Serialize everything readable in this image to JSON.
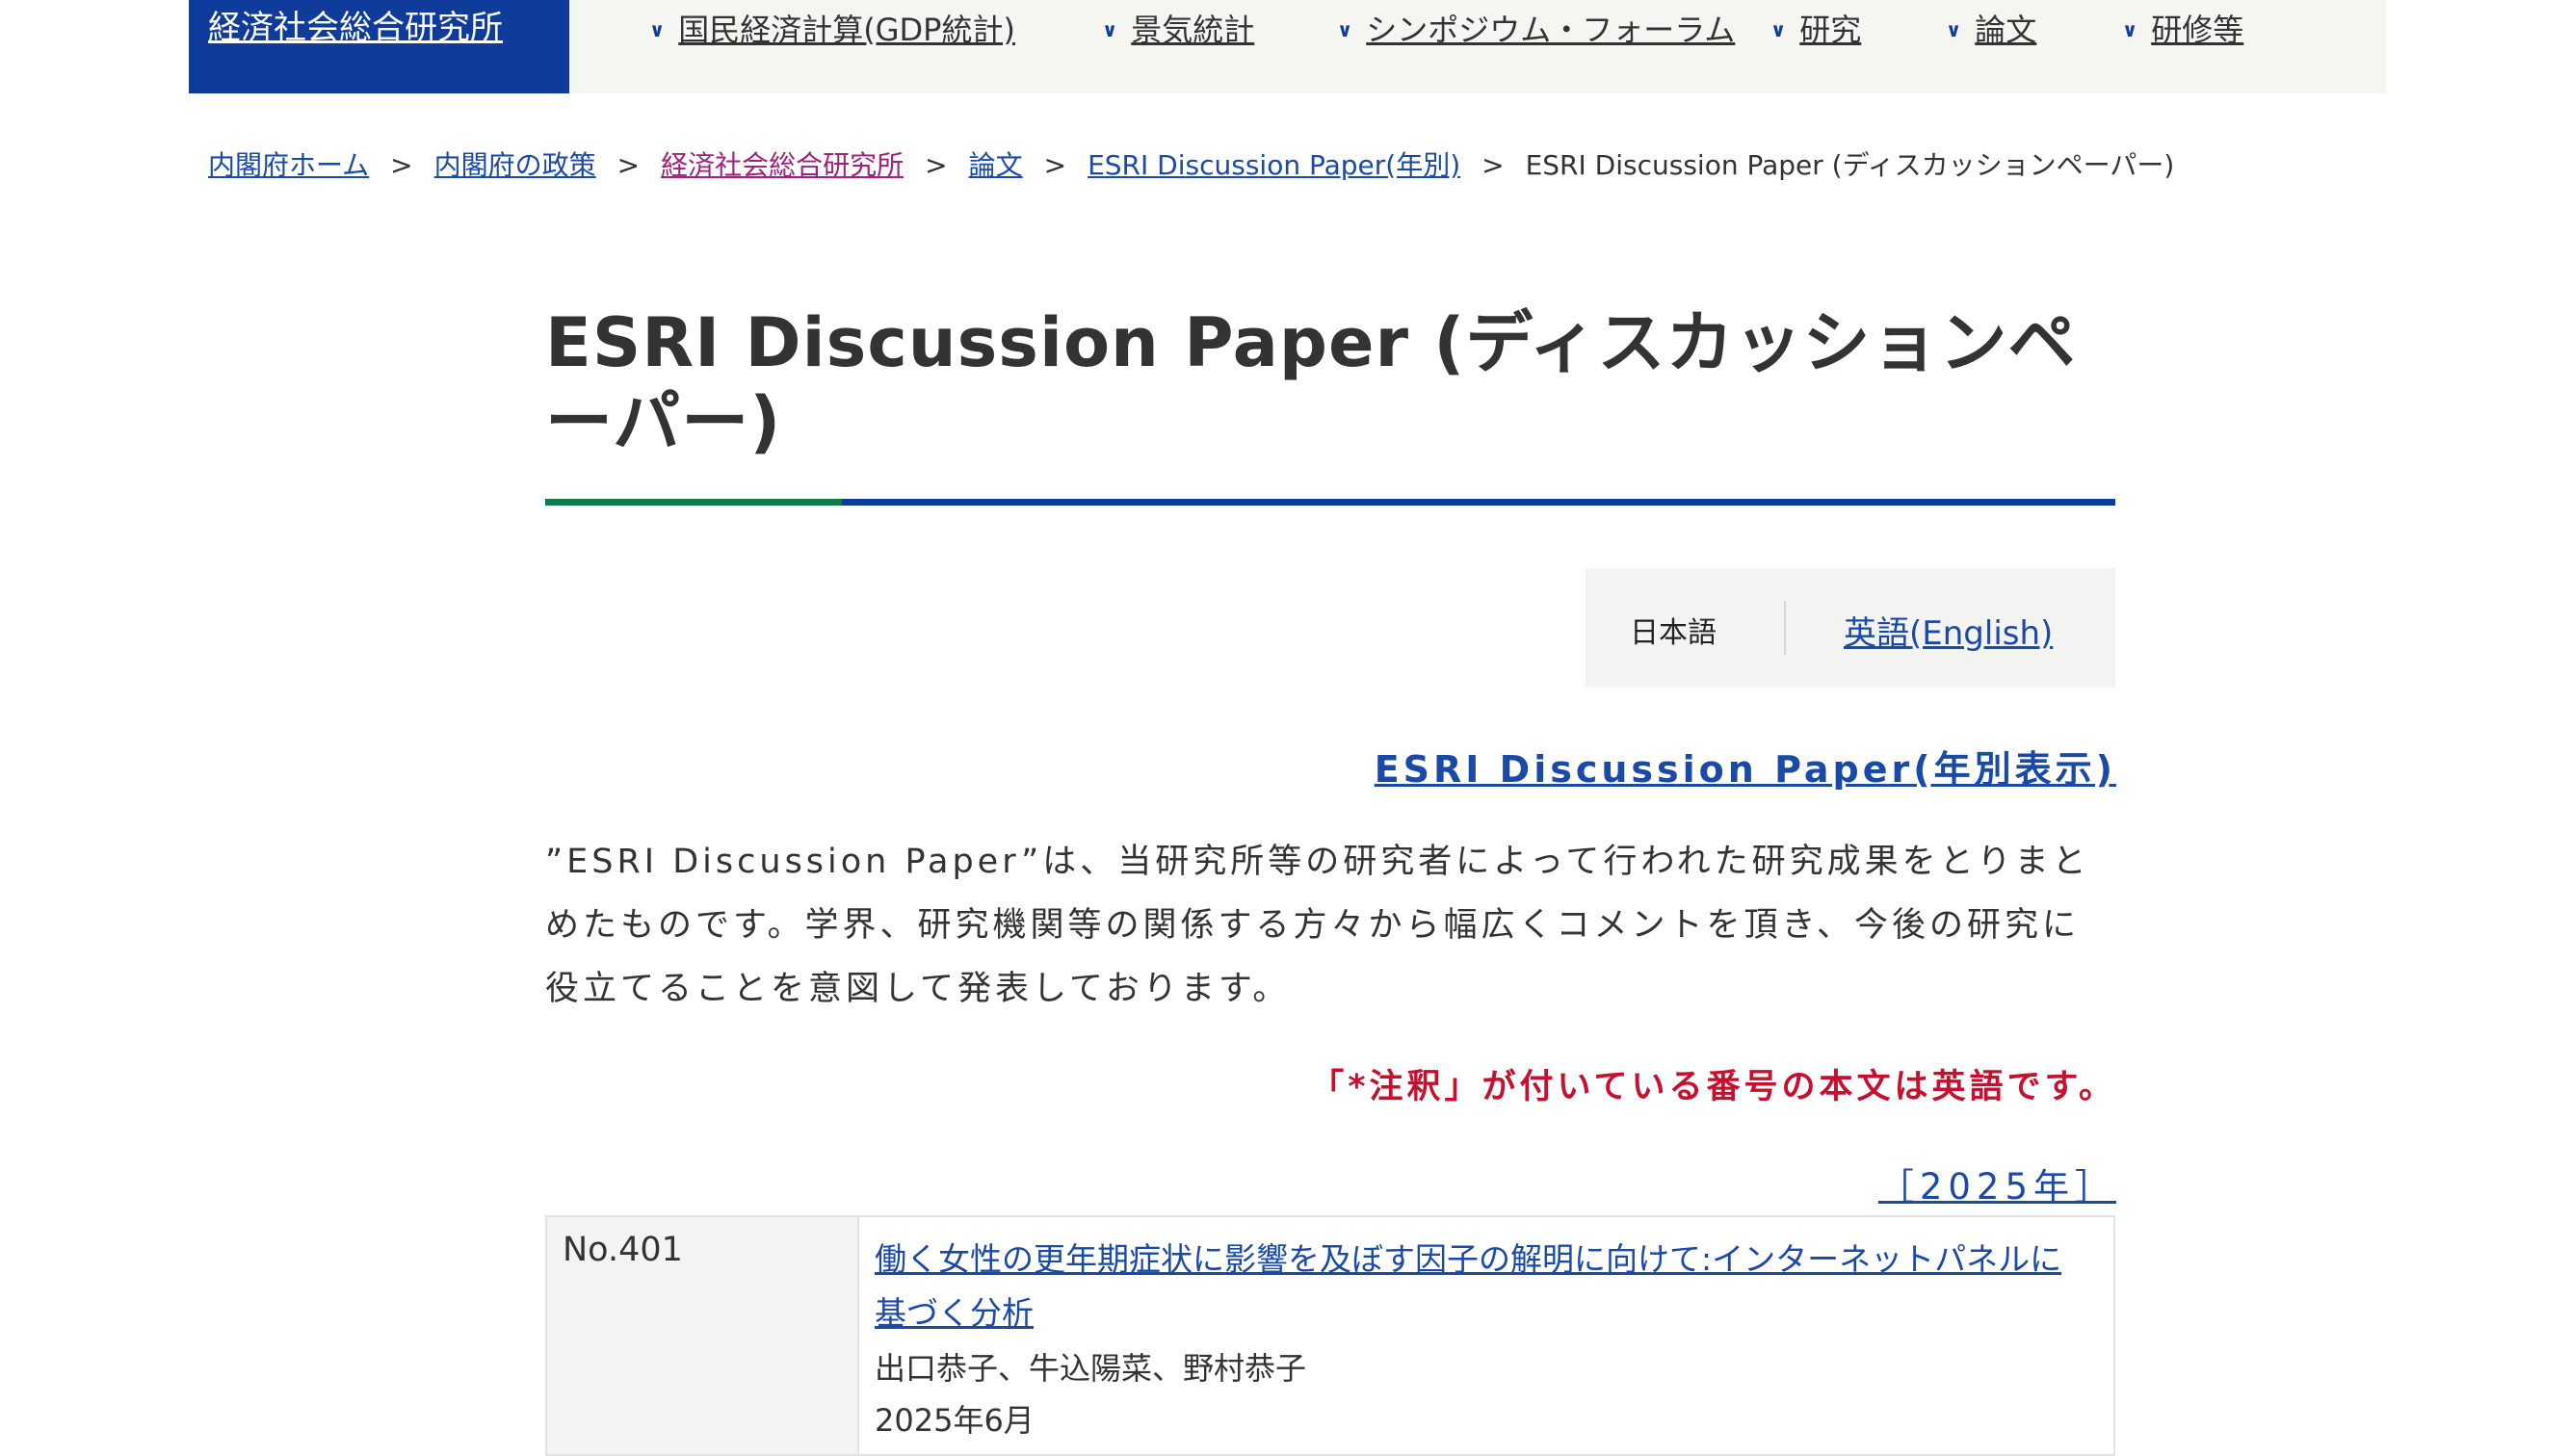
{
  "header": {
    "brand": "経済社会総合研究所",
    "menu": [
      {
        "label": "国民経済計算(GDP統計)"
      },
      {
        "label": "景気統計"
      },
      {
        "label": "シンポジウム・フォーラム"
      },
      {
        "label": "研究"
      },
      {
        "label": "論文"
      },
      {
        "label": "研修等"
      }
    ]
  },
  "breadcrumb": {
    "items": [
      "内閣府ホーム",
      "内閣府の政策",
      "経済社会総合研究所",
      "論文",
      "ESRI Discussion Paper(年別)"
    ],
    "current": "ESRI Discussion Paper (ディスカッションペーパー)",
    "separator": ">"
  },
  "page": {
    "title": "ESRI Discussion Paper (ディスカッションペーパー)",
    "lang_current": "日本語",
    "lang_other": "英語(English)",
    "yearly_link": "ESRI Discussion Paper(年別表示)",
    "description": "”ESRI Discussion Paper”は、当研究所等の研究者によって行われた研究成果をとりまとめたものです。学界、研究機関等の関係する方々から幅広くコメントを頂き、今後の研究に役立てることを意図して発表しております。",
    "note": "「*注釈」が付いている番号の本文は英語です。",
    "year_heading": "［2025年］"
  },
  "papers": [
    {
      "number": "No.401",
      "title": "働く女性の更年期症状に影響を及ぼす因子の解明に向けて:インターネットパネルに基づく分析",
      "authors": "出口恭子、牛込陽菜、野村恭子",
      "date": "2025年6月"
    }
  ],
  "colors": {
    "brand_blue": "#0f3c9b",
    "accent_green": "#0f7a4a",
    "note_red": "#c8102e",
    "link_blue": "#1a4aa8",
    "visited_link": "#a31f7a"
  }
}
